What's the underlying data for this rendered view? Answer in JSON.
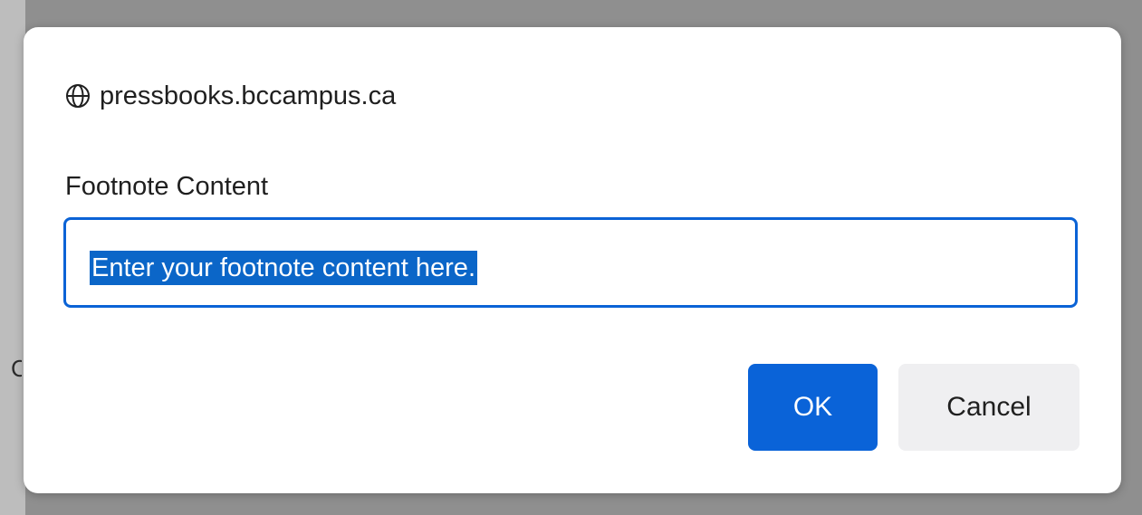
{
  "dialog": {
    "origin": "pressbooks.bccampus.ca",
    "origin_icon": "globe-icon",
    "field_label": "Footnote Content",
    "input_value": "Enter your footnote content here.",
    "ok_label": "OK",
    "cancel_label": "Cancel"
  },
  "backdrop": {
    "partial_glyph": "C"
  },
  "colors": {
    "accent": "#0A63D8",
    "selection": "#0B66C8",
    "cancel_bg": "#EFEFF1",
    "overlay": "#8F8F8F"
  }
}
